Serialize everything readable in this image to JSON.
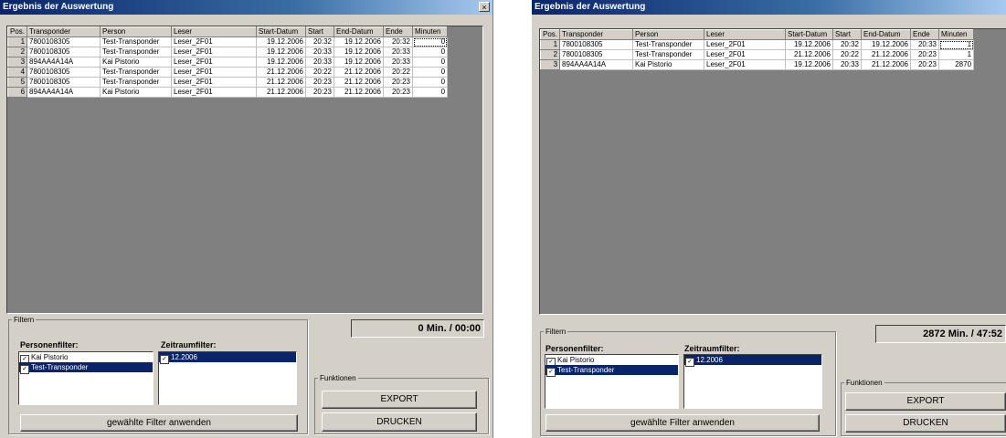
{
  "windows": [
    {
      "title": "Ergebnis der Auswertung",
      "close_glyph": "×",
      "columns": [
        "Pos.",
        "Transponder",
        "Person",
        "Leser",
        "Start-Datum",
        "Start",
        "End-Datum",
        "Ende",
        "Minuten"
      ],
      "rows": [
        [
          "1",
          "7800108305",
          "Test-Transponder",
          "Leser_2F01",
          "19.12.2006",
          "20:32",
          "19.12.2006",
          "20:32",
          "0"
        ],
        [
          "2",
          "7800108305",
          "Test-Transponder",
          "Leser_2F01",
          "19.12.2006",
          "20:33",
          "19.12.2006",
          "20:33",
          "0"
        ],
        [
          "3",
          "894AA4A14A",
          "Kai Pistorio",
          "Leser_2F01",
          "19.12.2006",
          "20:33",
          "19.12.2006",
          "20:33",
          "0"
        ],
        [
          "4",
          "7800108305",
          "Test-Transponder",
          "Leser_2F01",
          "21.12.2006",
          "20:22",
          "21.12.2006",
          "20:22",
          "0"
        ],
        [
          "5",
          "7800108305",
          "Test-Transponder",
          "Leser_2F01",
          "21.12.2006",
          "20:23",
          "21.12.2006",
          "20:23",
          "0"
        ],
        [
          "6",
          "894AA4A14A",
          "Kai Pistorio",
          "Leser_2F01",
          "21.12.2006",
          "20:23",
          "21.12.2006",
          "20:23",
          "0"
        ]
      ],
      "total": "0 Min. / 00:00",
      "filter_legend": "Filtern",
      "person_filter_label": "Personenfilter:",
      "person_items": [
        {
          "label": "Kai Pistorio",
          "checked": true,
          "selected": false
        },
        {
          "label": "Test-Transponder",
          "checked": true,
          "selected": true
        }
      ],
      "period_filter_label": "Zeitraumfilter:",
      "period_items": [
        {
          "label": "12.2006",
          "checked": true,
          "selected": true
        }
      ],
      "apply_button": "gewählte Filter anwenden",
      "functions_legend": "Funktionen",
      "export_button": "EXPORT",
      "print_button": "DRUCKEN"
    },
    {
      "title": "Ergebnis der Auswertung",
      "columns": [
        "Pos.",
        "Transponder",
        "Person",
        "Leser",
        "Start-Datum",
        "Start",
        "End-Datum",
        "Ende",
        "Minuten"
      ],
      "rows": [
        [
          "1",
          "7800108305",
          "Test-Transponder",
          "Leser_2F01",
          "19.12.2006",
          "20:32",
          "19.12.2006",
          "20:33",
          "1"
        ],
        [
          "2",
          "7800108305",
          "Test-Transponder",
          "Leser_2F01",
          "21.12.2006",
          "20:22",
          "21.12.2006",
          "20:23",
          "1"
        ],
        [
          "3",
          "894AA4A14A",
          "Kai Pistorio",
          "Leser_2F01",
          "19.12.2006",
          "20:33",
          "21.12.2006",
          "20:23",
          "2870"
        ]
      ],
      "total": "2872 Min. / 47:52",
      "filter_legend": "Filtern",
      "person_filter_label": "Personenfilter:",
      "person_items": [
        {
          "label": "Kai Pistorio",
          "checked": true,
          "selected": false
        },
        {
          "label": "Test-Transponder",
          "checked": true,
          "selected": true
        }
      ],
      "period_filter_label": "Zeitraumfilter:",
      "period_items": [
        {
          "label": "12.2006",
          "checked": true,
          "selected": true
        }
      ],
      "apply_button": "gewählte Filter anwenden",
      "functions_legend": "Funktionen",
      "export_button": "EXPORT",
      "print_button": "DRUCKEN"
    }
  ]
}
